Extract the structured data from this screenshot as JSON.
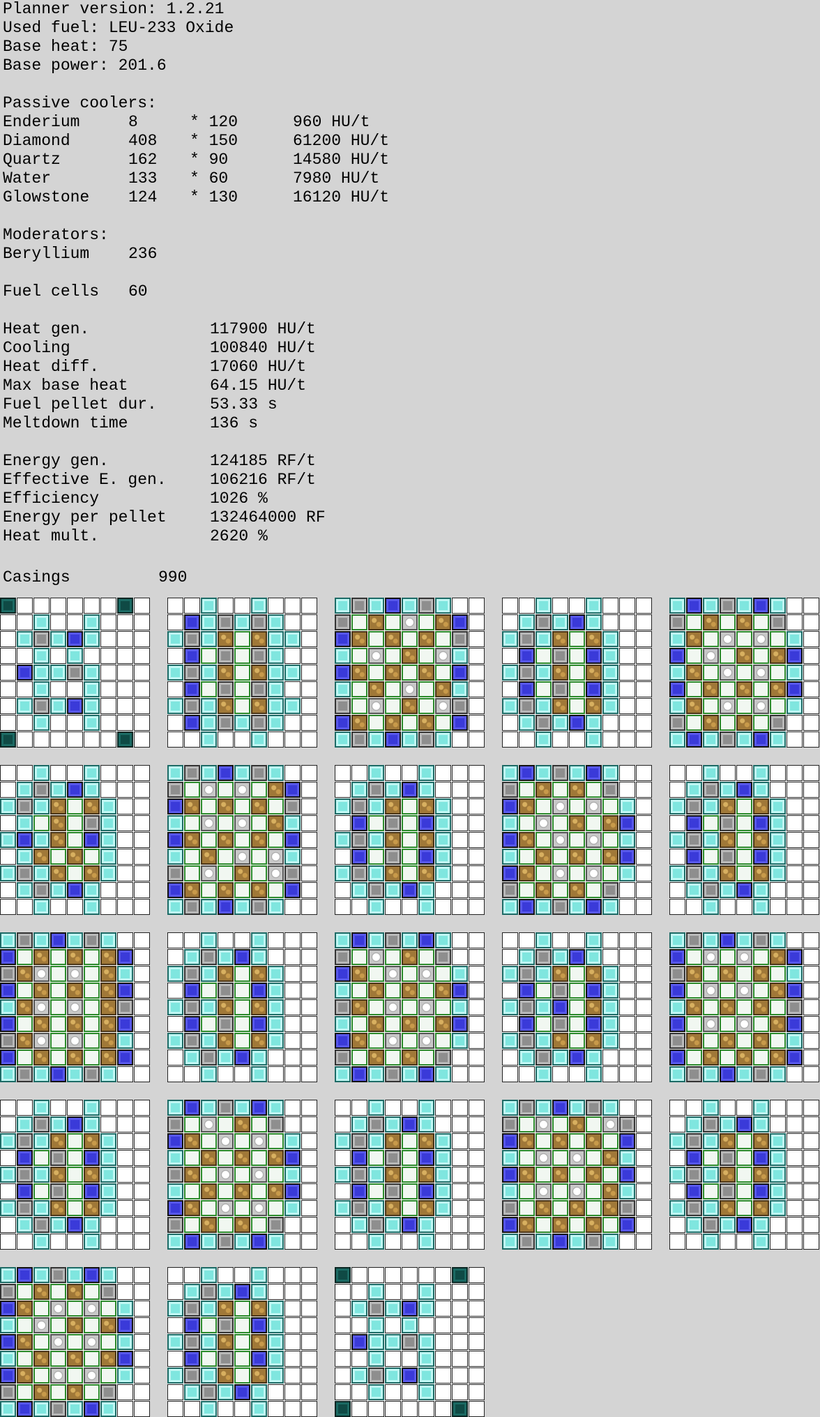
{
  "header": {
    "planner_version": "Planner version: 1.2.21",
    "used_fuel": "Used fuel: LEU-233 Oxide",
    "base_heat": "Base heat: 75",
    "base_power": "Base power: 201.6"
  },
  "passive_coolers": {
    "title": "Passive coolers:",
    "rows": [
      {
        "name": "Enderium",
        "count": "8",
        "mult": "* 120",
        "total": "960 HU/t"
      },
      {
        "name": "Diamond",
        "count": "408",
        "mult": "* 150",
        "total": "61200 HU/t"
      },
      {
        "name": "Quartz",
        "count": "162",
        "mult": "* 90",
        "total": "14580 HU/t"
      },
      {
        "name": "Water",
        "count": "133",
        "mult": "* 60",
        "total": "7980 HU/t"
      },
      {
        "name": "Glowstone",
        "count": "124",
        "mult": "* 130",
        "total": "16120 HU/t"
      }
    ]
  },
  "moderators": {
    "title": "Moderators:",
    "rows": [
      {
        "name": "Beryllium",
        "count": "236"
      }
    ]
  },
  "fuel_cells": {
    "label": "Fuel cells",
    "value": "60"
  },
  "heat_stats": [
    {
      "label": "Heat gen.",
      "value": "117900 HU/t"
    },
    {
      "label": "Cooling",
      "value": "100840 HU/t"
    },
    {
      "label": "Heat diff.",
      "value": "17060 HU/t"
    },
    {
      "label": "Max base heat",
      "value": "64.15 HU/t"
    },
    {
      "label": "Fuel pellet dur.",
      "value": "53.33 s"
    },
    {
      "label": "Meltdown time",
      "value": "136 s"
    }
  ],
  "energy_stats": [
    {
      "label": "Energy gen.",
      "value": "124185 RF/t"
    },
    {
      "label": "Effective E. gen.",
      "value": "106216 RF/t"
    },
    {
      "label": "Efficiency",
      "value": "1026 %"
    },
    {
      "label": "Energy per pellet",
      "value": "132464000 RF"
    },
    {
      "label": "Heat mult.",
      "value": "2620 %"
    }
  ],
  "casings": {
    "label": "Casings",
    "value": "990"
  },
  "legend": {
    "D": "diamond",
    "G": "glowstone",
    "W": "water",
    "B": "beryllium",
    "F": "fuel",
    "Q": "quartz",
    "E": "enderium",
    ".": "empty"
  },
  "colors": {
    "background": "#d4d4d4",
    "diamond": "#7fe6df",
    "glowstone": "#8e8e8e",
    "water": "#3a3ad9",
    "beryllium": "#2b8a2b",
    "fuel": "#a07838",
    "quartz": "#c8c8c8",
    "enderium": "#0f4a45"
  },
  "layers": [
    [
      "E......E",
      "..D..D..",
      ".DGDWD..",
      "..D.D...",
      ".WDDGD..",
      "..D..D..",
      ".DGDWD..",
      "..D..D..",
      "E......E"
    ],
    [
      "..D..D..",
      ".WDGDGD.",
      "DGDFBFDD",
      ".WBGBGD.",
      "DGDFBFDD",
      ".WBGBGD.",
      "DGDFBFDD",
      ".WDGDGD.",
      "..D..D.."
    ],
    [
      "DGDWDGD.",
      "GBFBQBFW",
      "WFBFBFBG",
      "DBQBFBQD",
      "WFBFBFBW",
      "DBFBQBFD",
      "GBQBFBQG",
      "WFBFBFBW",
      "DGDWDGD."
    ],
    [
      "..D..D..",
      ".DGDWD..",
      "DGDFBFD.",
      ".WBGBWD.",
      "DGDFBFD.",
      ".WBGBWD.",
      "DGDFBFD.",
      ".DGDWD..",
      "..D..D.."
    ],
    [
      "DWDGDWD.",
      "GBFBFBG.",
      "DFBQBQBD",
      "WBQBFBFW",
      "DFBQBQBD",
      "WBFBFBFW",
      "DFBQBQBD",
      "GBFBFBG.",
      "DWDGDWD."
    ],
    [
      "..D..D..",
      ".DGDWD..",
      "DGDFBFD.",
      ".DBFBGD.",
      "DWDFBWD.",
      ".DFBFBD.",
      "DGDFBFD.",
      ".DGDWD..",
      "..D..D.."
    ],
    [
      "DGDWDGD.",
      "GBQBQBFW",
      "WFBFBFBG",
      "DBQBQBFD",
      "WFBFBFBW",
      "DBFBQBQD",
      "GBQBFBQG",
      "WFBFBFBW",
      "DGDWDGD."
    ],
    [
      "..D..D..",
      ".DGDWD..",
      "DGDFBFD.",
      ".WBGBWD.",
      "DGDFBFD.",
      ".WBGBWD.",
      "DGDFBFD.",
      ".DGDWD..",
      "..D..D.."
    ],
    [
      "DWDGDWD.",
      "GBFBFBG.",
      "WFBQBQBD",
      "DBQBFBFW",
      "WFBQBQBD",
      "DBFBFBFW",
      "WFBQBQBD",
      "GBFBFBG.",
      "DWDGDWD."
    ],
    [
      "..D..D..",
      ".DGDWD..",
      "DGDFBFD.",
      ".WBGBWD.",
      "DGDFBFD.",
      ".WBGBWD.",
      "DGDFBFD.",
      ".DGDWD..",
      "..D..D.."
    ],
    [
      "DGDWDGD.",
      "WBFBFBFW",
      "GFQBQBFD",
      "WBFBFBFW",
      "DFQBQBFG",
      "WBFBFBFW",
      "GFQBQBFD",
      "WBFBFBFW",
      "DGDWDGD."
    ],
    [
      "..D..D..",
      ".DGDWD..",
      "DGDFBFD.",
      ".WBGBWD.",
      "DGDFBFD.",
      ".WBGBWD.",
      "DGDFBFD.",
      ".DGDWD..",
      "..D..D.."
    ],
    [
      "DWDGDWD.",
      "GBQBFBG.",
      "WFBQBQBD",
      "DBFBFBFW",
      "GFBQBQBD",
      "DBFBFBFW",
      "WFBQBQBD",
      "GBFBFBG.",
      "DWDGDWD."
    ],
    [
      "..D..D..",
      ".DGDWD..",
      "DGDFBFD.",
      ".WBGBWD.",
      "DGDWBFD.",
      ".WBGBWD.",
      "DGDFBFD.",
      ".DGDWD..",
      "..D..D.."
    ],
    [
      "DGDWDGD.",
      "WBQBQBFW",
      "GFBFBFBD",
      "WBQBQBFW",
      "DFBFBFBG",
      "WBQBQBFW",
      "GFBFBFBD",
      "WBFBFBFW",
      "DGDWDGD."
    ],
    [
      "..D..D..",
      ".DGDWD..",
      "DGDFBFD.",
      ".WBGBWD.",
      "DGDFBFD.",
      ".WBGBWD.",
      "DGDFBFD.",
      ".DGDWD..",
      "..D..D.."
    ],
    [
      "DWDGDWD.",
      "GBQBFBG.",
      "WFBQBQBD",
      "DBFBFBFW",
      "GFBQBQBD",
      "DBFBFBFW",
      "WFBQBQBD",
      "GBFBFBG.",
      "DWDGDWD."
    ],
    [
      "..D..D..",
      ".DGDWD..",
      "DGDFBFD.",
      ".WBGBWD.",
      "DGDFBFD.",
      ".WBGBWD.",
      "DGDFBFD.",
      ".DGDWD..",
      "..D..D.."
    ],
    [
      "DGDWDGD.",
      "GBQBFBQG",
      "WFBFBFBW",
      "DBQBQBFD",
      "WFBFBFBW",
      "DBQBQBFD",
      "GBFBFBFG",
      "WFBFBFBW",
      "DGDWDGD."
    ],
    [
      "..D..D..",
      ".DGDWD..",
      "DGDFBFD.",
      ".WBGBWD.",
      "DGDFBFD.",
      ".WBGBWD.",
      "DGDFBFD.",
      ".DGDWD..",
      "..D..D.."
    ],
    [
      "DWDGDWD.",
      "GBFBFBG.",
      "WFBQBQBD",
      "DBQBFBFW",
      "WFBQBQBD",
      "DBFBFBFW",
      "WFBQBQBD",
      "GBFBFBG.",
      "DWDGDWD."
    ],
    [
      "..D..D..",
      ".DGDWD..",
      "DGDFBFD.",
      ".WBGBWD.",
      "DGDFBFD.",
      ".WBGBWD.",
      "DGDFBFD.",
      ".DGDWD..",
      "..D..D.."
    ],
    [
      "E......E",
      "..D..D..",
      ".DGDWD..",
      "..D.D...",
      ".WDDGD..",
      "..D..D..",
      ".DGDWD..",
      "..D..D..",
      "E......E"
    ]
  ]
}
